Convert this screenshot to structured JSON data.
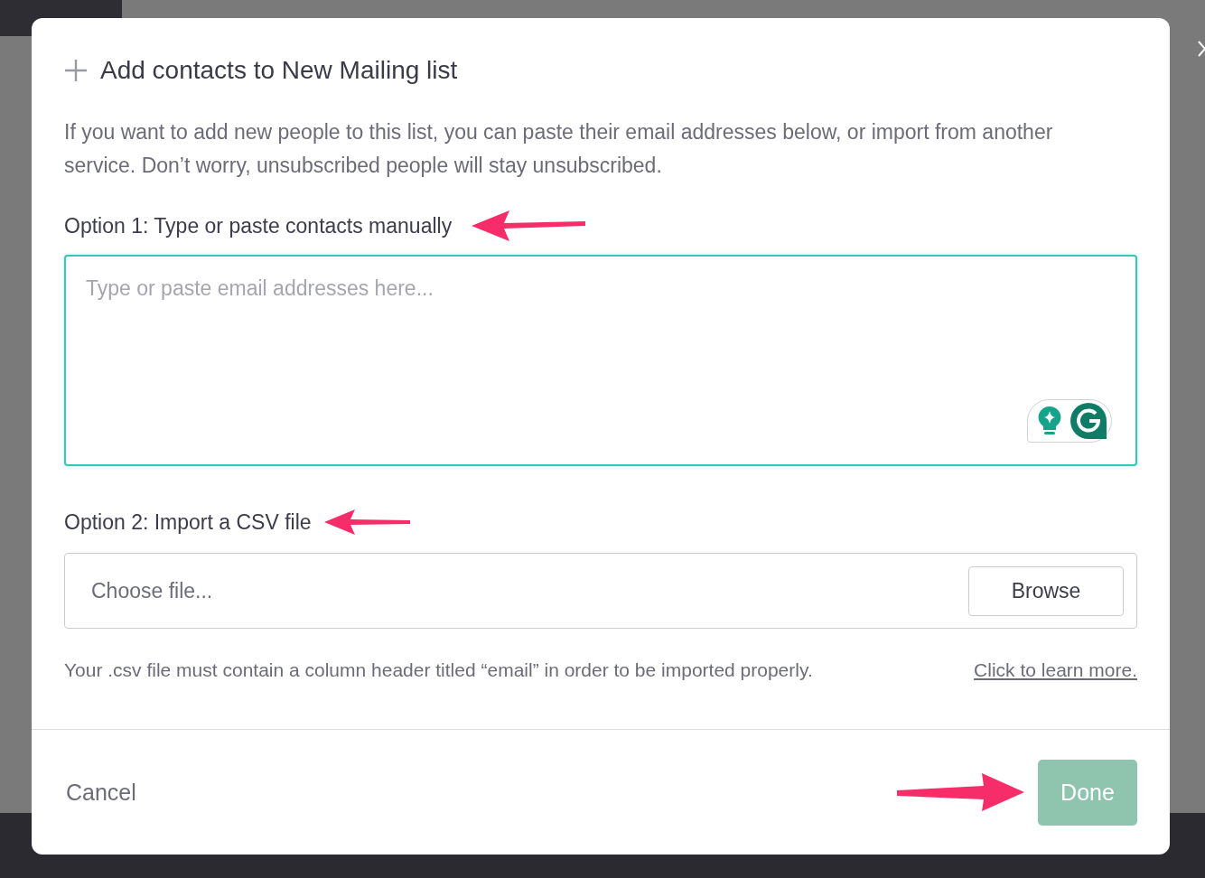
{
  "dialog": {
    "title": "Add contacts to New Mailing list",
    "intro": "If you want to add new people to this list, you can paste their email addresses below, or import from another service. Don’t worry, unsubscribed people will stay unsubscribed.",
    "option_1": {
      "label": "Option 1: Type or paste contacts manually",
      "placeholder": "Type or paste email addresses here...",
      "focused": true
    },
    "option_2": {
      "label": "Option 2: Import a CSV file",
      "file_placeholder": "Choose file...",
      "browse_button": "Browse"
    },
    "csv_note": "Your .csv file must contain a column header titled “email” in order to be imported properly.",
    "learn_more_link": "Click to learn more.",
    "cancel_button": "Cancel",
    "done_button": {
      "label": "Done",
      "disabled": true
    }
  }
}
